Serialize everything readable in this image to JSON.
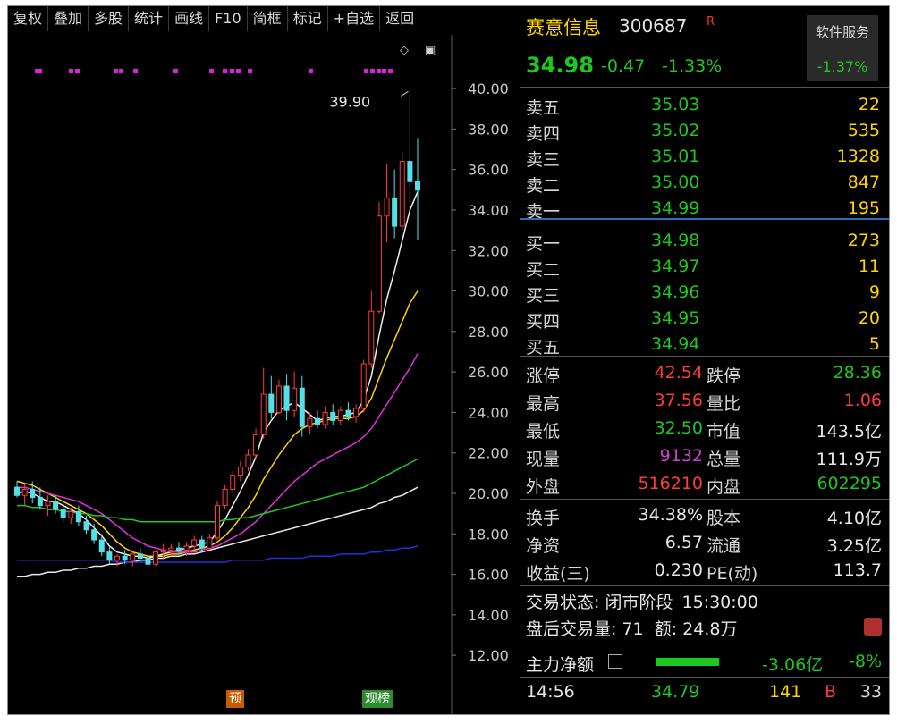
{
  "toolbar": {
    "items": [
      "复权",
      "叠加",
      "多股",
      "统计",
      "画线",
      "F10",
      "简框",
      "标记",
      "+自选",
      "返回"
    ]
  },
  "chart": {
    "peak_label": "39.90",
    "markers": [
      "预",
      "观榜"
    ],
    "y_axis_labels": [
      "40.00",
      "38.00",
      "36.00",
      "34.00",
      "32.00",
      "30.00",
      "28.00",
      "26.00",
      "24.00",
      "22.00",
      "20.00",
      "18.00",
      "16.00",
      "14.00",
      "12.00"
    ]
  },
  "chart_data": {
    "type": "candlestick",
    "ylim": [
      11.3,
      40.8
    ],
    "y_ticks": [
      40,
      38,
      36,
      34,
      32,
      30,
      28,
      26,
      24,
      22,
      20,
      18,
      16,
      14,
      12
    ],
    "candles": [
      {
        "o": 20.3,
        "h": 20.6,
        "l": 19.8,
        "c": 19.9
      },
      {
        "o": 19.9,
        "h": 20.5,
        "l": 19.4,
        "c": 20.2
      },
      {
        "o": 20.2,
        "h": 20.6,
        "l": 19.5,
        "c": 19.8
      },
      {
        "o": 19.8,
        "h": 20.3,
        "l": 19.2,
        "c": 19.4
      },
      {
        "o": 19.4,
        "h": 19.9,
        "l": 18.9,
        "c": 19.6
      },
      {
        "o": 19.6,
        "h": 19.9,
        "l": 19.0,
        "c": 19.2
      },
      {
        "o": 19.2,
        "h": 19.5,
        "l": 18.6,
        "c": 18.8
      },
      {
        "o": 18.8,
        "h": 19.3,
        "l": 18.5,
        "c": 19.1
      },
      {
        "o": 19.1,
        "h": 19.4,
        "l": 18.4,
        "c": 18.6
      },
      {
        "o": 18.6,
        "h": 18.9,
        "l": 18.0,
        "c": 18.2
      },
      {
        "o": 18.2,
        "h": 18.5,
        "l": 17.5,
        "c": 17.7
      },
      {
        "o": 17.7,
        "h": 18.0,
        "l": 16.9,
        "c": 17.1
      },
      {
        "o": 17.1,
        "h": 17.4,
        "l": 16.5,
        "c": 16.7
      },
      {
        "o": 16.7,
        "h": 17.0,
        "l": 16.4,
        "c": 16.9
      },
      {
        "o": 16.9,
        "h": 17.2,
        "l": 16.5,
        "c": 16.7
      },
      {
        "o": 16.7,
        "h": 17.1,
        "l": 16.4,
        "c": 17.0
      },
      {
        "o": 17.0,
        "h": 17.3,
        "l": 16.6,
        "c": 16.8
      },
      {
        "o": 16.8,
        "h": 17.0,
        "l": 16.2,
        "c": 16.5
      },
      {
        "o": 16.5,
        "h": 17.2,
        "l": 16.4,
        "c": 17.1
      },
      {
        "o": 17.1,
        "h": 17.5,
        "l": 16.8,
        "c": 17.2
      },
      {
        "o": 17.2,
        "h": 17.5,
        "l": 16.9,
        "c": 17.3
      },
      {
        "o": 17.3,
        "h": 17.6,
        "l": 17.0,
        "c": 17.2
      },
      {
        "o": 17.2,
        "h": 17.6,
        "l": 16.9,
        "c": 17.4
      },
      {
        "o": 17.4,
        "h": 17.9,
        "l": 17.2,
        "c": 17.7
      },
      {
        "o": 17.7,
        "h": 17.9,
        "l": 17.1,
        "c": 17.3
      },
      {
        "o": 17.3,
        "h": 18.0,
        "l": 17.2,
        "c": 17.8
      },
      {
        "o": 17.8,
        "h": 19.6,
        "l": 17.7,
        "c": 19.4
      },
      {
        "o": 19.4,
        "h": 20.4,
        "l": 19.2,
        "c": 20.2
      },
      {
        "o": 20.2,
        "h": 21.1,
        "l": 20.0,
        "c": 20.9
      },
      {
        "o": 20.9,
        "h": 21.6,
        "l": 20.6,
        "c": 21.3
      },
      {
        "o": 21.3,
        "h": 22.2,
        "l": 21.1,
        "c": 21.9
      },
      {
        "o": 21.9,
        "h": 23.2,
        "l": 21.7,
        "c": 22.9
      },
      {
        "o": 22.9,
        "h": 26.2,
        "l": 22.7,
        "c": 24.9
      },
      {
        "o": 24.9,
        "h": 25.8,
        "l": 23.7,
        "c": 24.0
      },
      {
        "o": 24.0,
        "h": 25.6,
        "l": 23.9,
        "c": 25.3
      },
      {
        "o": 25.3,
        "h": 25.9,
        "l": 23.6,
        "c": 24.1
      },
      {
        "o": 24.1,
        "h": 26.0,
        "l": 23.8,
        "c": 25.2
      },
      {
        "o": 25.2,
        "h": 25.8,
        "l": 22.8,
        "c": 23.3
      },
      {
        "o": 23.3,
        "h": 24.0,
        "l": 22.9,
        "c": 23.7
      },
      {
        "o": 23.7,
        "h": 24.1,
        "l": 23.2,
        "c": 23.4
      },
      {
        "o": 23.4,
        "h": 24.3,
        "l": 23.2,
        "c": 24.0
      },
      {
        "o": 24.0,
        "h": 24.4,
        "l": 23.4,
        "c": 23.6
      },
      {
        "o": 23.6,
        "h": 24.3,
        "l": 23.4,
        "c": 24.1
      },
      {
        "o": 24.1,
        "h": 24.5,
        "l": 23.6,
        "c": 23.8
      },
      {
        "o": 23.8,
        "h": 24.4,
        "l": 23.5,
        "c": 24.2
      },
      {
        "o": 24.2,
        "h": 26.6,
        "l": 24.0,
        "c": 26.4
      },
      {
        "o": 26.4,
        "h": 30.0,
        "l": 26.2,
        "c": 29.0
      },
      {
        "o": 29.0,
        "h": 34.4,
        "l": 28.9,
        "c": 33.7
      },
      {
        "o": 33.7,
        "h": 36.3,
        "l": 32.4,
        "c": 34.6
      },
      {
        "o": 34.6,
        "h": 36.0,
        "l": 32.6,
        "c": 33.2
      },
      {
        "o": 33.2,
        "h": 36.9,
        "l": 33.0,
        "c": 36.4
      },
      {
        "o": 36.4,
        "h": 39.9,
        "l": 33.9,
        "c": 35.4
      },
      {
        "o": 35.4,
        "h": 37.56,
        "l": 32.5,
        "c": 34.98
      }
    ],
    "ma_lines": [
      {
        "color": "#f0f0f0",
        "values": [
          20.0,
          20.1,
          20.0,
          19.8,
          19.6,
          19.6,
          19.4,
          19.2,
          19.0,
          18.7,
          18.3,
          17.9,
          17.4,
          17.1,
          17.0,
          16.9,
          16.9,
          16.8,
          16.9,
          17.0,
          17.1,
          17.2,
          17.3,
          17.4,
          17.5,
          17.6,
          18.1,
          18.7,
          19.4,
          20.1,
          20.9,
          21.8,
          23.0,
          23.6,
          24.1,
          24.3,
          24.5,
          24.2,
          23.9,
          23.6,
          23.7,
          23.8,
          23.8,
          23.9,
          24.0,
          24.6,
          25.8,
          27.8,
          29.6,
          31.0,
          32.5,
          34.0,
          34.9
        ]
      },
      {
        "color": "#ffd400",
        "values": [
          20.6,
          20.5,
          20.4,
          20.2,
          20.0,
          19.8,
          19.6,
          19.4,
          19.2,
          19.0,
          18.7,
          18.4,
          18.0,
          17.6,
          17.3,
          17.1,
          17.0,
          16.9,
          16.9,
          16.9,
          17.0,
          17.0,
          17.1,
          17.2,
          17.3,
          17.4,
          17.6,
          17.9,
          18.3,
          18.8,
          19.3,
          19.9,
          20.7,
          21.3,
          21.9,
          22.4,
          22.9,
          23.2,
          23.4,
          23.5,
          23.6,
          23.7,
          23.7,
          23.7,
          23.8,
          24.1,
          24.7,
          25.7,
          26.7,
          27.6,
          28.5,
          29.4,
          30.0
        ]
      },
      {
        "color": "#e030e0",
        "values": [
          20.3,
          20.3,
          20.2,
          20.1,
          20.0,
          19.9,
          19.8,
          19.7,
          19.6,
          19.4,
          19.2,
          19.0,
          18.7,
          18.4,
          18.1,
          17.8,
          17.6,
          17.4,
          17.3,
          17.2,
          17.1,
          17.1,
          17.1,
          17.1,
          17.2,
          17.3,
          17.4,
          17.6,
          17.8,
          18.0,
          18.3,
          18.6,
          19.0,
          19.4,
          19.8,
          20.2,
          20.6,
          20.9,
          21.2,
          21.5,
          21.7,
          21.9,
          22.1,
          22.3,
          22.5,
          22.8,
          23.2,
          23.8,
          24.4,
          25.0,
          25.6,
          26.2,
          26.9
        ]
      },
      {
        "color": "#1ec81e",
        "values": [
          19.4,
          19.4,
          19.3,
          19.3,
          19.2,
          19.2,
          19.1,
          19.1,
          19.0,
          19.0,
          18.9,
          18.9,
          18.8,
          18.8,
          18.7,
          18.7,
          18.6,
          18.6,
          18.6,
          18.6,
          18.6,
          18.6,
          18.6,
          18.6,
          18.6,
          18.6,
          18.6,
          18.7,
          18.7,
          18.8,
          18.8,
          18.9,
          19.0,
          19.1,
          19.2,
          19.3,
          19.4,
          19.5,
          19.6,
          19.7,
          19.8,
          19.9,
          20.0,
          20.1,
          20.2,
          20.3,
          20.5,
          20.7,
          20.9,
          21.1,
          21.3,
          21.5,
          21.7
        ]
      },
      {
        "color": "#e8e8e8",
        "values": [
          15.9,
          15.9,
          16.0,
          16.0,
          16.1,
          16.1,
          16.2,
          16.2,
          16.3,
          16.3,
          16.4,
          16.4,
          16.5,
          16.5,
          16.6,
          16.6,
          16.7,
          16.7,
          16.8,
          16.8,
          16.9,
          16.9,
          17.0,
          17.0,
          17.1,
          17.2,
          17.3,
          17.4,
          17.5,
          17.6,
          17.7,
          17.8,
          17.9,
          18.0,
          18.1,
          18.2,
          18.3,
          18.4,
          18.5,
          18.6,
          18.7,
          18.8,
          18.9,
          19.0,
          19.1,
          19.2,
          19.3,
          19.5,
          19.6,
          19.8,
          19.9,
          20.1,
          20.3
        ]
      },
      {
        "color": "#2a2ae0",
        "values": [
          16.7,
          16.7,
          16.7,
          16.7,
          16.7,
          16.7,
          16.7,
          16.7,
          16.7,
          16.7,
          16.7,
          16.7,
          16.7,
          16.6,
          16.6,
          16.6,
          16.6,
          16.6,
          16.6,
          16.6,
          16.6,
          16.6,
          16.6,
          16.6,
          16.6,
          16.6,
          16.6,
          16.6,
          16.7,
          16.7,
          16.7,
          16.7,
          16.7,
          16.8,
          16.8,
          16.8,
          16.8,
          16.8,
          16.9,
          16.9,
          16.9,
          16.9,
          17.0,
          17.0,
          17.0,
          17.0,
          17.1,
          17.1,
          17.2,
          17.2,
          17.3,
          17.3,
          17.4
        ]
      }
    ]
  },
  "stock": {
    "name": "赛意信息",
    "code": "300687",
    "flag": "R",
    "price": "34.98",
    "change": "-0.47",
    "change_pct": "-1.33%",
    "soft_service_label": "软件服务",
    "soft_service_pct": "-1.37%"
  },
  "orderbook": {
    "asks": [
      {
        "label": "卖五",
        "price": "35.03",
        "vol": "22"
      },
      {
        "label": "卖四",
        "price": "35.02",
        "vol": "535"
      },
      {
        "label": "卖三",
        "price": "35.01",
        "vol": "1328"
      },
      {
        "label": "卖二",
        "price": "35.00",
        "vol": "847"
      },
      {
        "label": "卖一",
        "price": "34.99",
        "vol": "195"
      }
    ],
    "bids": [
      {
        "label": "买一",
        "price": "34.98",
        "vol": "273"
      },
      {
        "label": "买二",
        "price": "34.97",
        "vol": "11"
      },
      {
        "label": "买三",
        "price": "34.96",
        "vol": "9"
      },
      {
        "label": "买四",
        "price": "34.95",
        "vol": "20"
      },
      {
        "label": "买五",
        "price": "34.94",
        "vol": "5"
      }
    ]
  },
  "stats1": [
    {
      "l1": "涨停",
      "v1": "42.54",
      "c1": "red",
      "l2": "跌停",
      "v2": "28.36",
      "c2": "green"
    },
    {
      "l1": "最高",
      "v1": "37.56",
      "c1": "red",
      "l2": "量比",
      "v2": "1.06",
      "c2": "red"
    },
    {
      "l1": "最低",
      "v1": "32.50",
      "c1": "green",
      "l2": "市值",
      "v2": "143.5亿",
      "c2": "white"
    },
    {
      "l1": "现量",
      "v1": "9132",
      "c1": "magenta",
      "l2": "总量",
      "v2": "111.9万",
      "c2": "white"
    },
    {
      "l1": "外盘",
      "v1": "516210",
      "c1": "red",
      "l2": "内盘",
      "v2": "602295",
      "c2": "green"
    }
  ],
  "stats2": [
    {
      "l1": "换手",
      "v1": "34.38%",
      "c1": "white",
      "l2": "股本",
      "v2": "4.10亿",
      "c2": "white"
    },
    {
      "l1": "净资",
      "v1": "6.57",
      "c1": "white",
      "l2": "流通",
      "v2": "3.25亿",
      "c2": "white"
    },
    {
      "l1": "收益(三)",
      "v1": "0.230",
      "c1": "white",
      "l2": "PE(动)",
      "v2": "113.7",
      "c2": "white"
    }
  ],
  "trade_status": {
    "label": "交易状态:",
    "status": "闭市阶段",
    "time": "15:30:00",
    "after_label": "盘后交易量:",
    "after_vol": "71",
    "amount_label": "额:",
    "amount": "24.8万"
  },
  "main_flow": {
    "label": "主力净额",
    "value": "-3.06亿",
    "pct": "-8%"
  },
  "ticks": [
    {
      "time": "14:56",
      "price": "34.79",
      "vol": "141",
      "side": "B",
      "count": "33"
    }
  ]
}
